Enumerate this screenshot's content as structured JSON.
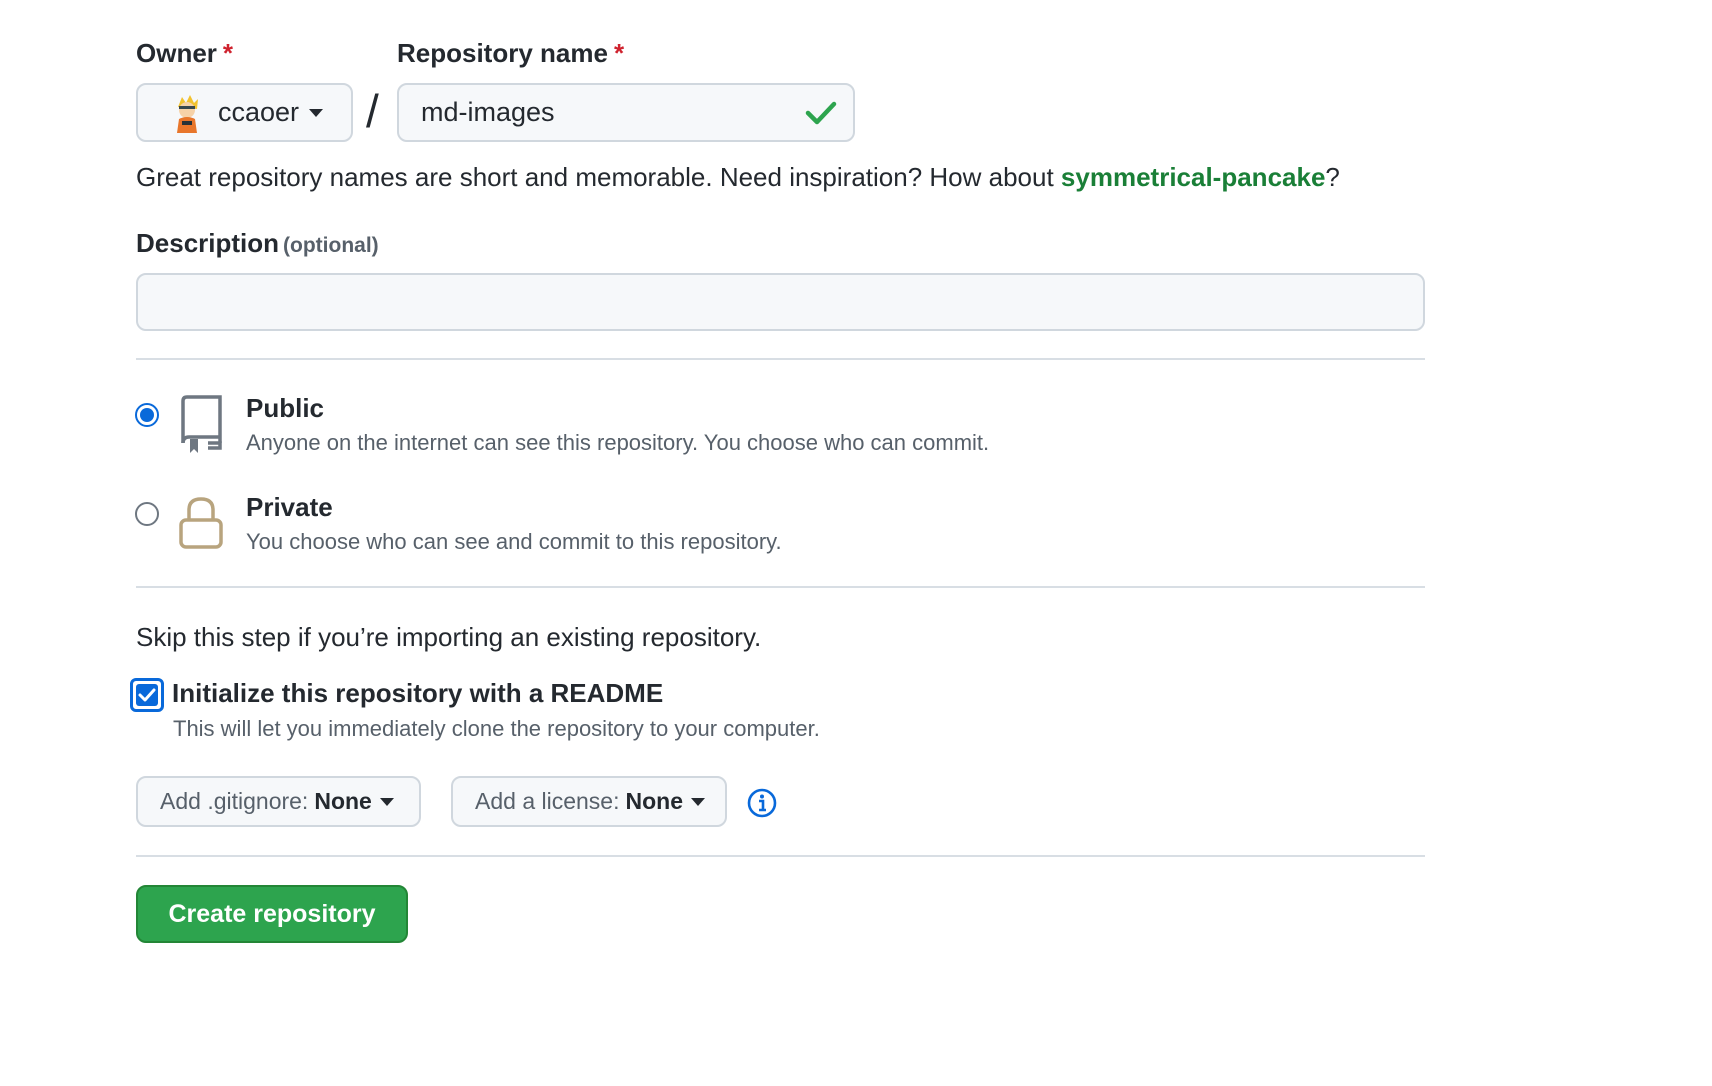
{
  "owner": {
    "label": "Owner",
    "required_mark": "*",
    "selected": "ccaoer"
  },
  "separator": "/",
  "repo_name": {
    "label": "Repository name",
    "required_mark": "*",
    "value": "md-images",
    "valid": true
  },
  "name_hint": {
    "prefix": "Great repository names are short and memorable. Need inspiration? How about ",
    "suggestion": "symmetrical-pancake",
    "suffix": "?"
  },
  "description": {
    "label": "Description",
    "optional": "(optional)",
    "value": "",
    "placeholder": ""
  },
  "visibility": {
    "selected": "public",
    "options": [
      {
        "id": "public",
        "title": "Public",
        "desc": "Anyone on the internet can see this repository. You choose who can commit."
      },
      {
        "id": "private",
        "title": "Private",
        "desc": "You choose who can see and commit to this repository."
      }
    ]
  },
  "init": {
    "skip_text": "Skip this step if you’re importing an existing repository.",
    "readme": {
      "checked": true,
      "title": "Initialize this repository with a README",
      "desc": "This will let you immediately clone the repository to your computer."
    },
    "gitignore": {
      "prefix": "Add .gitignore:",
      "value": "None"
    },
    "license": {
      "prefix": "Add a license:",
      "value": "None"
    }
  },
  "submit": {
    "label": "Create repository"
  },
  "colors": {
    "accent": "#0969da",
    "success": "#2da44e",
    "suggestion": "#1a7f37",
    "required": "#cf222e",
    "lock": "#b8a47e"
  },
  "icons": [
    "avatar",
    "caret-down-icon",
    "check-icon",
    "repo-icon",
    "lock-icon",
    "info-icon"
  ]
}
